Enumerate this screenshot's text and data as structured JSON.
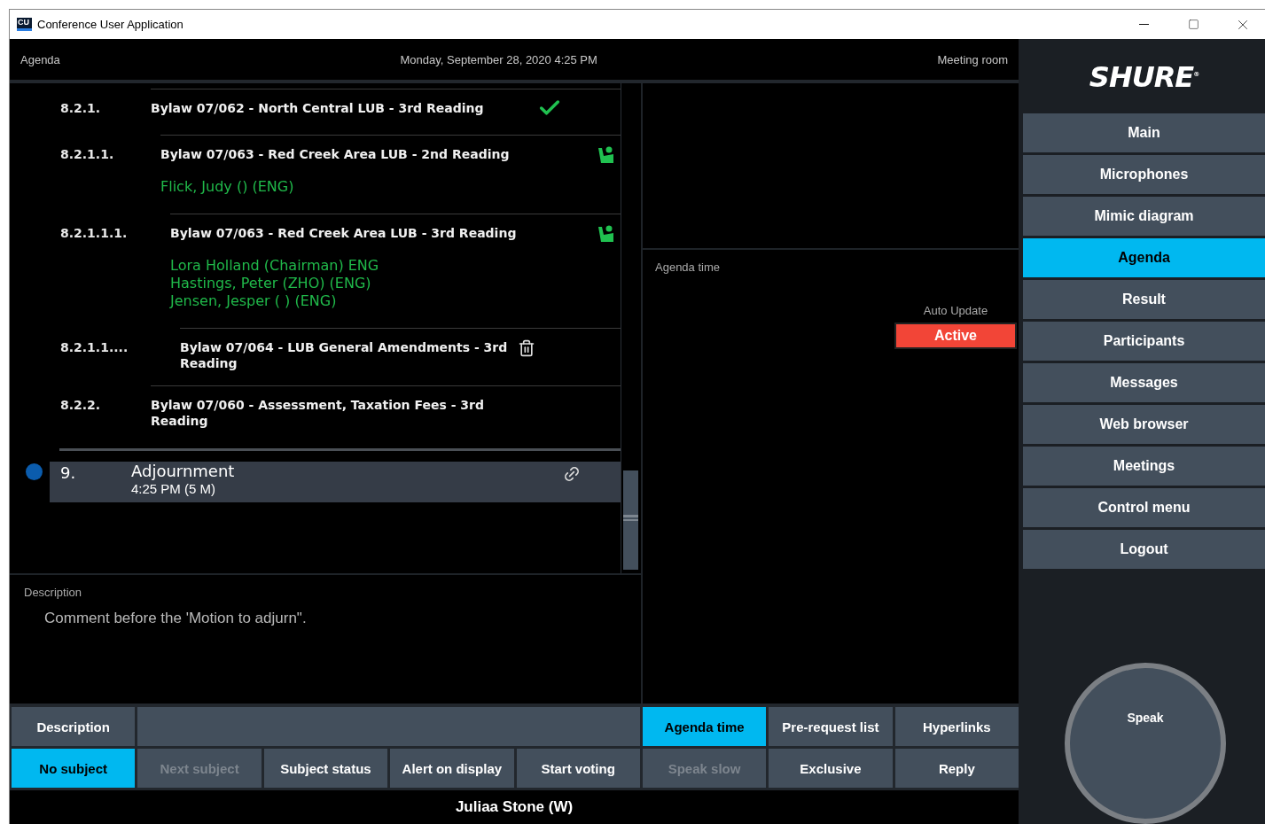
{
  "window": {
    "title": "Conference User Application",
    "app_icon": "CU"
  },
  "header": {
    "section": "Agenda",
    "datetime": "Monday, September 28, 2020 4:25 PM",
    "room": "Meeting room"
  },
  "agenda": [
    {
      "number": "8.2.1.",
      "title": "Bylaw 07/062 - North Central  LUB - 3rd Reading",
      "kind": "approved",
      "selected": false,
      "children": [
        {
          "number": "8.2.1.1.",
          "title": "Bylaw 07/063 - Red Creek Area LUB - 2nd Reading",
          "kind": "speaking",
          "selected": false,
          "speakers": [
            "Flick, Judy  () (ENG)"
          ],
          "children": [
            {
              "number": "8.2.1.1.1.",
              "title": "Bylaw 07/063 - Red Creek Area LUB - 3rd Reading",
              "kind": "speaking",
              "selected": false,
              "speakers": [
                "Lora Holland (Chairman) ENG",
                "Hastings, Peter  (ZHO) (ENG)",
                "Jensen, Jesper  ( ) (ENG)"
              ],
              "children": [
                {
                  "number": "8.2.1.1....",
                  "title": "Bylaw 07/064 - LUB General Amendments - 3rd Reading",
                  "kind": "deleted",
                  "selected": false
                }
              ]
            }
          ]
        }
      ]
    },
    {
      "number": "8.2.2.",
      "title": "Bylaw 07/060 - Assessment, Taxation Fees - 3rd Reading",
      "kind": "plain",
      "selected": false
    },
    {
      "number": "9.",
      "title": "Adjournment",
      "time": "4:25 PM (5 M)",
      "kind": "linked",
      "selected": true
    }
  ],
  "description": {
    "label": "Description",
    "text": "Comment before the 'Motion to adjurn\"."
  },
  "agenda_time": {
    "label": "Agenda time",
    "auto_update_label": "Auto Update",
    "auto_update_button": {
      "label": "Active",
      "on": true
    }
  },
  "tabs_left": [
    {
      "label": "Description",
      "selected": false
    }
  ],
  "tabs_right": [
    {
      "label": "Agenda time",
      "selected": true
    },
    {
      "label": "Pre-request list",
      "selected": false
    },
    {
      "label": "Hyperlinks",
      "selected": false
    }
  ],
  "actions": [
    {
      "label": "No subject",
      "selected": true,
      "disabled": false
    },
    {
      "label": "Next subject",
      "selected": false,
      "disabled": true
    },
    {
      "label": "Subject status",
      "selected": false,
      "disabled": false
    },
    {
      "label": "Alert on display",
      "selected": false,
      "disabled": false
    },
    {
      "label": "Start voting",
      "selected": false,
      "disabled": false
    },
    {
      "label": "Speak slow",
      "selected": false,
      "disabled": true
    },
    {
      "label": "Exclusive",
      "selected": false,
      "disabled": false
    },
    {
      "label": "Reply",
      "selected": false,
      "disabled": false
    }
  ],
  "status_bar": "Juliaa Stone (W)",
  "sidebar": {
    "logo": "SHURE$^{®}$",
    "items": [
      {
        "label": "Main",
        "selected": false
      },
      {
        "label": "Microphones",
        "selected": false
      },
      {
        "label": "Mimic diagram",
        "selected": false
      },
      {
        "label": "Agenda",
        "selected": true
      },
      {
        "label": "Result",
        "selected": false
      },
      {
        "label": "Participants",
        "selected": false
      },
      {
        "label": "Messages",
        "selected": false
      },
      {
        "label": "Web browser",
        "selected": false
      },
      {
        "label": "Meetings",
        "selected": false
      },
      {
        "label": "Control menu",
        "selected": false
      },
      {
        "label": "Logout",
        "selected": false
      }
    ],
    "speak_button": "Speak"
  }
}
